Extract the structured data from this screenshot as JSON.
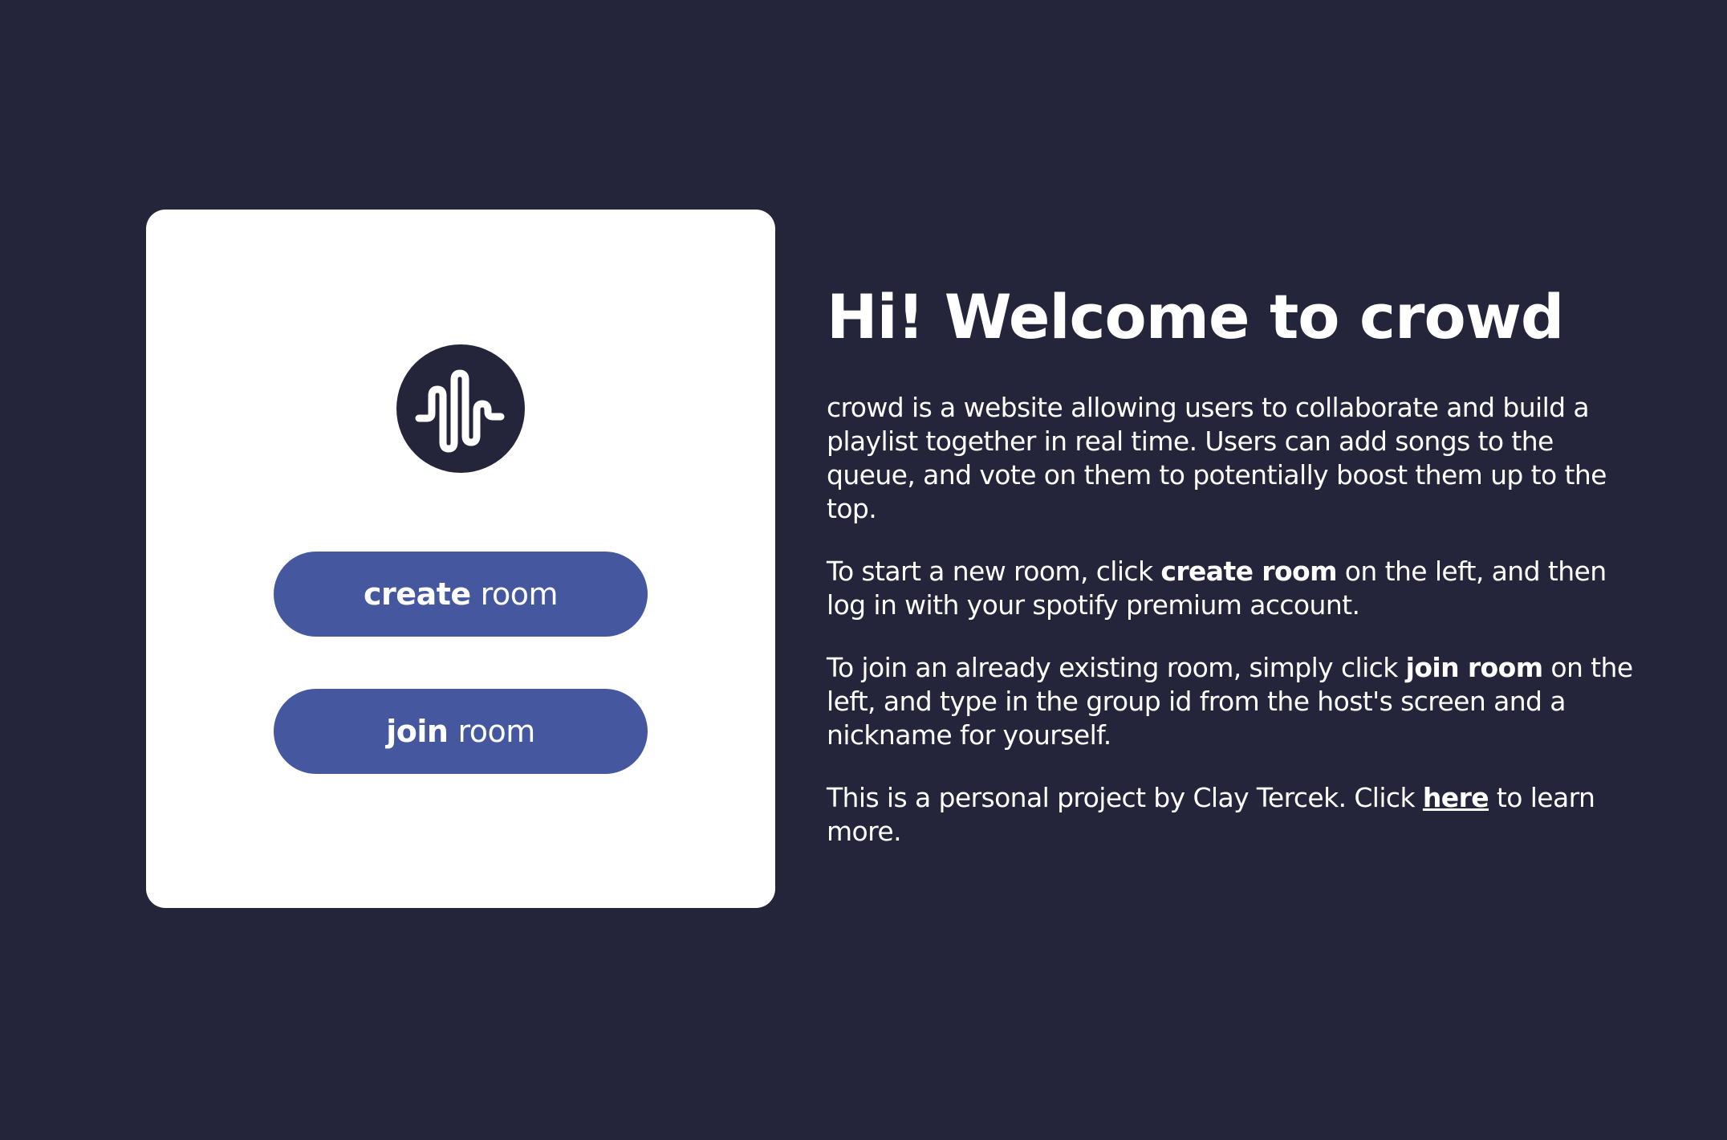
{
  "colors": {
    "background": "#24253b",
    "card": "#ffffff",
    "button": "#45589f",
    "text": "#ffffff"
  },
  "card": {
    "logo_icon": "sound-wave-icon",
    "create_button": {
      "bold": "create",
      "light": "room"
    },
    "join_button": {
      "bold": "join",
      "light": "room"
    }
  },
  "info": {
    "title": "Hi! Welcome to crowd",
    "paragraph1": "crowd is a website allowing users to collaborate and build a playlist together in real time. Users can add songs to the queue, and vote on them to potentially boost them up to the top.",
    "paragraph2": {
      "before": "To start a new room, click ",
      "bold": "create room",
      "after": " on the left, and then log in with your spotify premium account."
    },
    "paragraph3": {
      "before": "To join an already existing room, simply click ",
      "bold": "join room",
      "after": " on the left, and type in the group id from the host's screen and a nickname for yourself."
    },
    "paragraph4": {
      "before": "This is a personal project by Clay Tercek. Click ",
      "link": "here",
      "after": " to learn more."
    }
  }
}
